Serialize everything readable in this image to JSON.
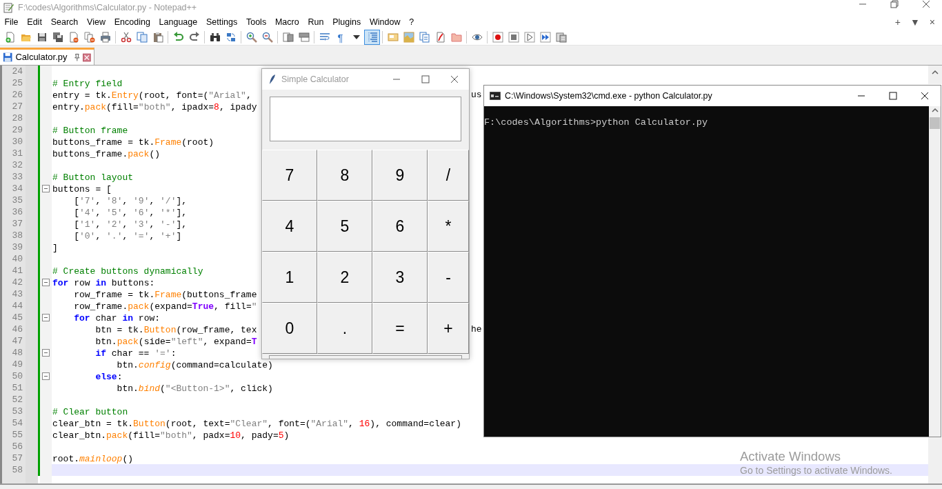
{
  "window": {
    "title": "F:\\codes\\Algorithms\\Calculator.py - Notepad++"
  },
  "menu": [
    "File",
    "Edit",
    "Search",
    "View",
    "Encoding",
    "Language",
    "Settings",
    "Tools",
    "Macro",
    "Run",
    "Plugins",
    "Window",
    "?"
  ],
  "menu_controls": [
    "+",
    "▼",
    "×"
  ],
  "toolbar": [
    {
      "pressed": false
    },
    {
      "pressed": false
    },
    {
      "pressed": false
    },
    {
      "pressed": false
    },
    {
      "pressed": false
    },
    {
      "pressed": false
    },
    {
      "pressed": false
    },
    {
      "pressed": false
    },
    {
      "pressed": false
    },
    {
      "pressed": false
    },
    {
      "pressed": false
    },
    {
      "pressed": false
    },
    {
      "pressed": false
    },
    {
      "pressed": false
    },
    {
      "pressed": false
    },
    {
      "pressed": false
    },
    {
      "pressed": false
    },
    {
      "pressed": false
    },
    {
      "pressed": false
    },
    {
      "glyph": "¶",
      "pressed": false
    },
    {
      "pressed": false
    },
    {
      "pressed": true
    },
    {
      "pressed": false
    },
    {
      "pressed": false
    },
    {
      "pressed": false
    },
    {
      "pressed": false
    },
    {
      "pressed": false
    },
    {
      "pressed": false
    },
    {
      "pressed": false
    },
    {
      "pressed": false
    },
    {
      "pressed": false
    },
    {
      "pressed": false
    },
    {
      "pressed": false
    }
  ],
  "tabs": [
    {
      "label": "Calculator.py",
      "selected": true
    }
  ],
  "editor": {
    "lines": [
      {
        "number": "24",
        "changed": true,
        "current": false
      },
      {
        "number": "25",
        "changed": true,
        "current": false,
        "segments": [
          {
            "kind": "comment",
            "text": "# Entry field"
          }
        ]
      },
      {
        "number": "26",
        "changed": true,
        "current": false,
        "segments": [
          {
            "kind": "plain",
            "text": "entry = tk."
          },
          {
            "kind": "name",
            "text": "Entry"
          },
          {
            "kind": "plain",
            "text": "(root, font=("
          },
          {
            "kind": "string",
            "text": "\"Arial\""
          },
          {
            "kind": "plain",
            "text": ","
          }
        ],
        "tail": "us"
      },
      {
        "number": "27",
        "changed": true,
        "current": false,
        "segments": [
          {
            "kind": "plain",
            "text": "entry."
          },
          {
            "kind": "name",
            "text": "pack"
          },
          {
            "kind": "plain",
            "text": "(fill="
          },
          {
            "kind": "string",
            "text": "\"both\""
          },
          {
            "kind": "plain",
            "text": ", ipadx="
          },
          {
            "kind": "number",
            "text": "8"
          },
          {
            "kind": "plain",
            "text": ", ipady"
          }
        ]
      },
      {
        "number": "28",
        "changed": true,
        "current": false
      },
      {
        "number": "29",
        "changed": true,
        "current": false,
        "segments": [
          {
            "kind": "comment",
            "text": "# Button frame"
          }
        ]
      },
      {
        "number": "30",
        "changed": true,
        "current": false,
        "segments": [
          {
            "kind": "plain",
            "text": "buttons_frame = tk."
          },
          {
            "kind": "name",
            "text": "Frame"
          },
          {
            "kind": "plain",
            "text": "(root)"
          }
        ]
      },
      {
        "number": "31",
        "changed": true,
        "current": false,
        "segments": [
          {
            "kind": "plain",
            "text": "buttons_frame."
          },
          {
            "kind": "name",
            "text": "pack"
          },
          {
            "kind": "plain",
            "text": "()"
          }
        ]
      },
      {
        "number": "32",
        "changed": true,
        "current": false
      },
      {
        "number": "33",
        "changed": true,
        "current": false,
        "segments": [
          {
            "kind": "comment",
            "text": "# Button layout"
          }
        ]
      },
      {
        "number": "34",
        "changed": true,
        "current": false,
        "folded": false,
        "segments": [
          {
            "kind": "plain",
            "text": "buttons = ["
          }
        ]
      },
      {
        "number": "35",
        "changed": true,
        "current": false,
        "segments": [
          {
            "kind": "plain",
            "text": "    ["
          },
          {
            "kind": "string",
            "text": "'7'"
          },
          {
            "kind": "plain",
            "text": ", "
          },
          {
            "kind": "string",
            "text": "'8'"
          },
          {
            "kind": "plain",
            "text": ", "
          },
          {
            "kind": "string",
            "text": "'9'"
          },
          {
            "kind": "plain",
            "text": ", "
          },
          {
            "kind": "string",
            "text": "'/'"
          },
          {
            "kind": "plain",
            "text": "],"
          }
        ]
      },
      {
        "number": "36",
        "changed": true,
        "current": false,
        "segments": [
          {
            "kind": "plain",
            "text": "    ["
          },
          {
            "kind": "string",
            "text": "'4'"
          },
          {
            "kind": "plain",
            "text": ", "
          },
          {
            "kind": "string",
            "text": "'5'"
          },
          {
            "kind": "plain",
            "text": ", "
          },
          {
            "kind": "string",
            "text": "'6'"
          },
          {
            "kind": "plain",
            "text": ", "
          },
          {
            "kind": "string",
            "text": "'*'"
          },
          {
            "kind": "plain",
            "text": "],"
          }
        ]
      },
      {
        "number": "37",
        "changed": true,
        "current": false,
        "segments": [
          {
            "kind": "plain",
            "text": "    ["
          },
          {
            "kind": "string",
            "text": "'1'"
          },
          {
            "kind": "plain",
            "text": ", "
          },
          {
            "kind": "string",
            "text": "'2'"
          },
          {
            "kind": "plain",
            "text": ", "
          },
          {
            "kind": "string",
            "text": "'3'"
          },
          {
            "kind": "plain",
            "text": ", "
          },
          {
            "kind": "string",
            "text": "'-'"
          },
          {
            "kind": "plain",
            "text": "],"
          }
        ]
      },
      {
        "number": "38",
        "changed": true,
        "current": false,
        "segments": [
          {
            "kind": "plain",
            "text": "    ["
          },
          {
            "kind": "string",
            "text": "'0'"
          },
          {
            "kind": "plain",
            "text": ", "
          },
          {
            "kind": "string",
            "text": "'.'"
          },
          {
            "kind": "plain",
            "text": ", "
          },
          {
            "kind": "string",
            "text": "'='"
          },
          {
            "kind": "plain",
            "text": ", "
          },
          {
            "kind": "string",
            "text": "'+'"
          },
          {
            "kind": "plain",
            "text": "]"
          }
        ]
      },
      {
        "number": "39",
        "changed": true,
        "current": false,
        "segments": [
          {
            "kind": "plain",
            "text": "]"
          }
        ]
      },
      {
        "number": "40",
        "changed": true,
        "current": false
      },
      {
        "number": "41",
        "changed": true,
        "current": false,
        "segments": [
          {
            "kind": "comment",
            "text": "# Create buttons dynamically"
          }
        ]
      },
      {
        "number": "42",
        "changed": true,
        "current": false,
        "folded": false,
        "segments": [
          {
            "kind": "keyword",
            "text": "for"
          },
          {
            "kind": "plain",
            "text": " row "
          },
          {
            "kind": "keyword",
            "text": "in"
          },
          {
            "kind": "plain",
            "text": " buttons:"
          }
        ]
      },
      {
        "number": "43",
        "changed": true,
        "current": false,
        "segments": [
          {
            "kind": "plain",
            "text": "    row_frame = tk."
          },
          {
            "kind": "name",
            "text": "Frame"
          },
          {
            "kind": "plain",
            "text": "(buttons_frame"
          }
        ]
      },
      {
        "number": "44",
        "changed": true,
        "current": false,
        "segments": [
          {
            "kind": "plain",
            "text": "    row_frame."
          },
          {
            "kind": "name",
            "text": "pack"
          },
          {
            "kind": "plain",
            "text": "(expand="
          },
          {
            "kind": "constant",
            "text": "True"
          },
          {
            "kind": "plain",
            "text": ", fill="
          },
          {
            "kind": "string",
            "text": "\""
          }
        ]
      },
      {
        "number": "45",
        "changed": true,
        "current": false,
        "folded": false,
        "segments": [
          {
            "kind": "keyword",
            "text": "    for"
          },
          {
            "kind": "plain",
            "text": " char "
          },
          {
            "kind": "keyword",
            "text": "in"
          },
          {
            "kind": "plain",
            "text": " row:"
          }
        ]
      },
      {
        "number": "46",
        "changed": true,
        "current": false,
        "segments": [
          {
            "kind": "plain",
            "text": "        btn = tk."
          },
          {
            "kind": "name",
            "text": "Button"
          },
          {
            "kind": "plain",
            "text": "(row_frame, tex"
          }
        ],
        "tail": "he"
      },
      {
        "number": "47",
        "changed": true,
        "current": false,
        "segments": [
          {
            "kind": "plain",
            "text": "        btn."
          },
          {
            "kind": "name",
            "text": "pack"
          },
          {
            "kind": "plain",
            "text": "(side="
          },
          {
            "kind": "string",
            "text": "\"left\""
          },
          {
            "kind": "plain",
            "text": ", expand="
          },
          {
            "kind": "constant",
            "text": "T"
          }
        ]
      },
      {
        "number": "48",
        "changed": true,
        "current": false,
        "folded": false,
        "segments": [
          {
            "kind": "keyword",
            "text": "        if"
          },
          {
            "kind": "plain",
            "text": " char == "
          },
          {
            "kind": "string",
            "text": "'='"
          },
          {
            "kind": "plain",
            "text": ":"
          }
        ]
      },
      {
        "number": "49",
        "changed": true,
        "current": false,
        "segments": [
          {
            "kind": "plain",
            "text": "            btn."
          },
          {
            "kind": "italic-name",
            "text": "config"
          },
          {
            "kind": "plain",
            "text": "(command=calculate)"
          }
        ]
      },
      {
        "number": "50",
        "changed": true,
        "current": false,
        "folded": false,
        "segments": [
          {
            "kind": "keyword",
            "text": "        else"
          },
          {
            "kind": "plain",
            "text": ":"
          }
        ]
      },
      {
        "number": "51",
        "changed": true,
        "current": false,
        "segments": [
          {
            "kind": "plain",
            "text": "            btn."
          },
          {
            "kind": "italic-name",
            "text": "bind"
          },
          {
            "kind": "plain",
            "text": "("
          },
          {
            "kind": "string",
            "text": "\"<Button-1>\""
          },
          {
            "kind": "plain",
            "text": ", click)"
          }
        ]
      },
      {
        "number": "52",
        "changed": true,
        "current": false
      },
      {
        "number": "53",
        "changed": true,
        "current": false,
        "segments": [
          {
            "kind": "comment",
            "text": "# Clear button"
          }
        ]
      },
      {
        "number": "54",
        "changed": true,
        "current": false,
        "segments": [
          {
            "kind": "plain",
            "text": "clear_btn = tk."
          },
          {
            "kind": "name",
            "text": "Button"
          },
          {
            "kind": "plain",
            "text": "(root, text="
          },
          {
            "kind": "string",
            "text": "\"Clear\""
          },
          {
            "kind": "plain",
            "text": ", font=("
          },
          {
            "kind": "string",
            "text": "\"Arial\""
          },
          {
            "kind": "plain",
            "text": ", "
          },
          {
            "kind": "number",
            "text": "16"
          },
          {
            "kind": "plain",
            "text": "), command=clear)"
          }
        ]
      },
      {
        "number": "55",
        "changed": true,
        "current": false,
        "segments": [
          {
            "kind": "plain",
            "text": "clear_btn."
          },
          {
            "kind": "name",
            "text": "pack"
          },
          {
            "kind": "plain",
            "text": "(fill="
          },
          {
            "kind": "string",
            "text": "\"both\""
          },
          {
            "kind": "plain",
            "text": ", padx="
          },
          {
            "kind": "number",
            "text": "10"
          },
          {
            "kind": "plain",
            "text": ", pady="
          },
          {
            "kind": "number",
            "text": "5"
          },
          {
            "kind": "plain",
            "text": ")"
          }
        ]
      },
      {
        "number": "56",
        "changed": true,
        "current": false
      },
      {
        "number": "57",
        "changed": true,
        "current": false,
        "segments": [
          {
            "kind": "plain",
            "text": "root."
          },
          {
            "kind": "italic-name",
            "text": "mainloop"
          },
          {
            "kind": "plain",
            "text": "()"
          }
        ]
      },
      {
        "number": "58",
        "changed": true,
        "current": true
      }
    ]
  },
  "calculator": {
    "title": "Simple Calculator",
    "keys": [
      [
        "7",
        "8",
        "9",
        "/"
      ],
      [
        "4",
        "5",
        "6",
        "*"
      ],
      [
        "1",
        "2",
        "3",
        "-"
      ],
      [
        "0",
        ".",
        "=",
        "+"
      ]
    ]
  },
  "console": {
    "title": "C:\\Windows\\System32\\cmd.exe - python  Calculator.py",
    "lines": [
      "F:\\codes\\Algorithms>python Calculator.py"
    ]
  },
  "activation_notice": {
    "heading": "Activate Windows",
    "text": "Go to Settings to activate Windows."
  }
}
